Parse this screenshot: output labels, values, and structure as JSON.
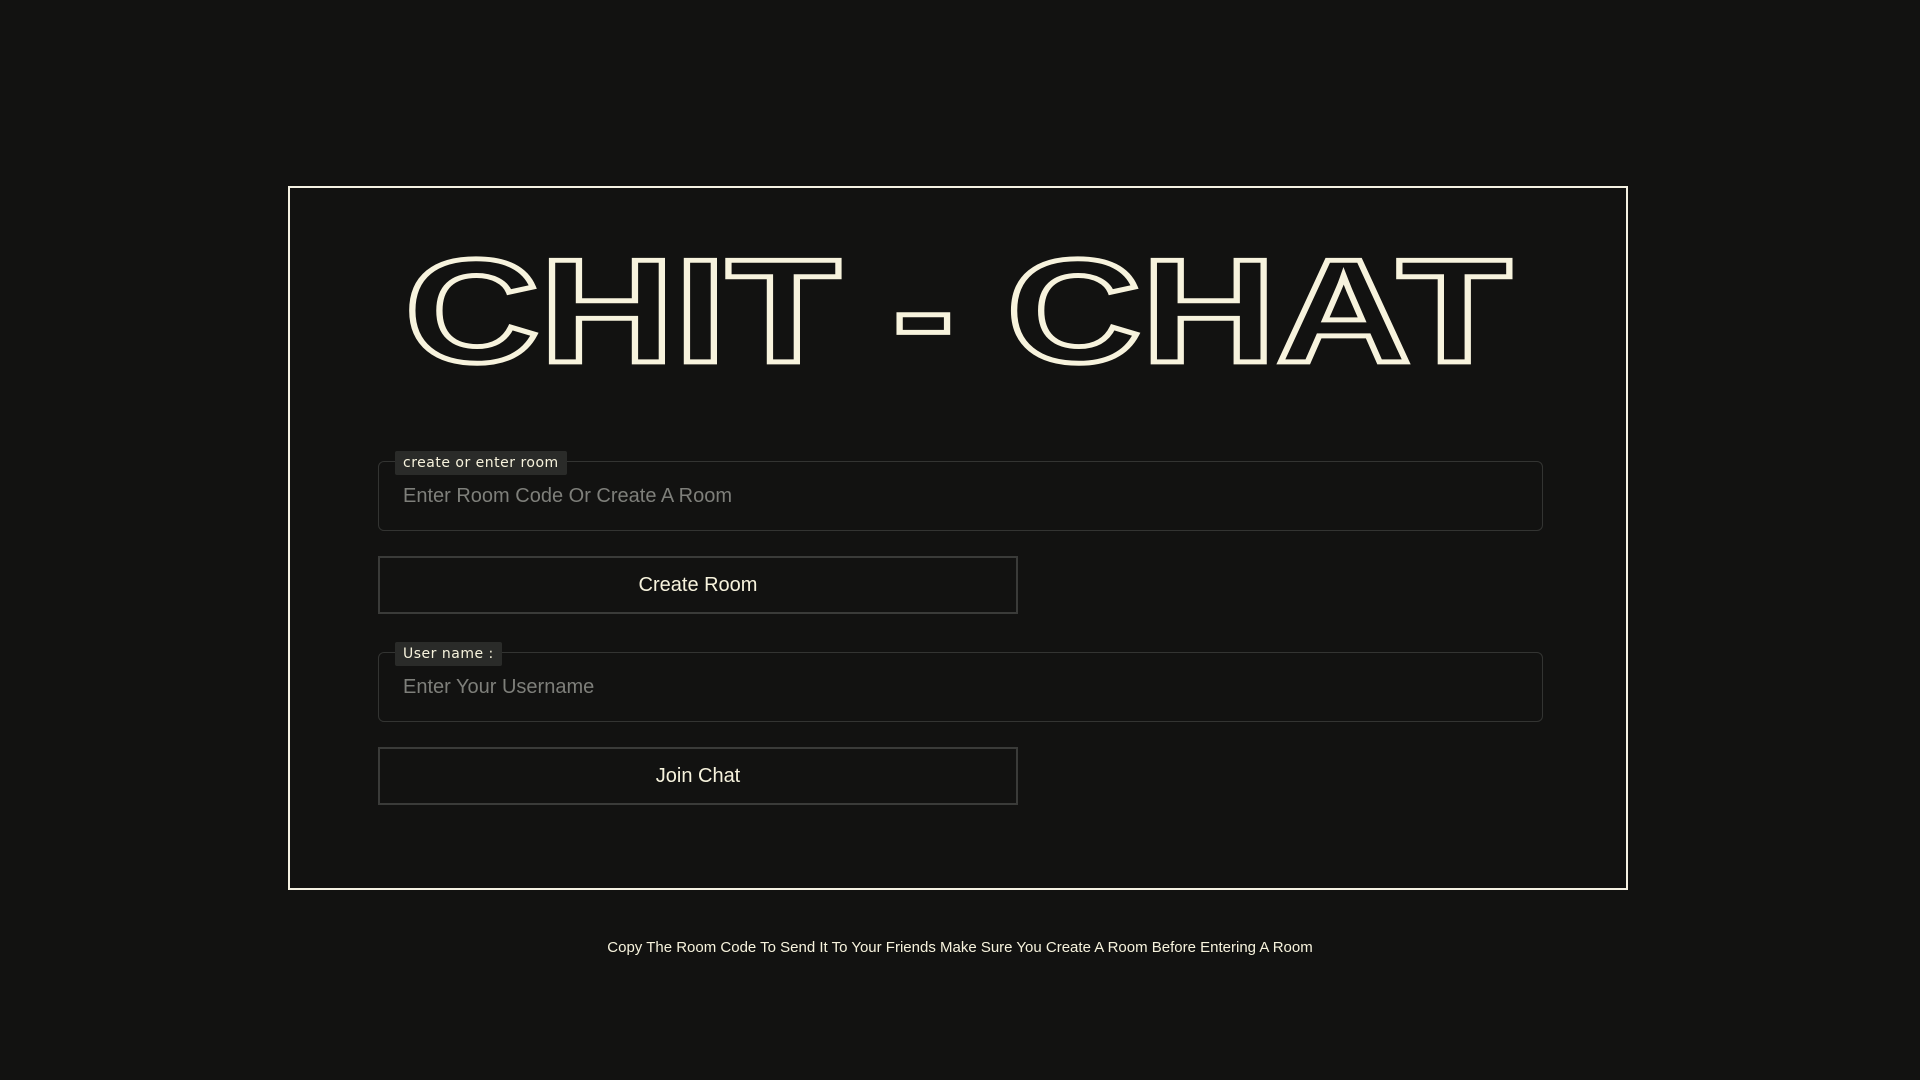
{
  "app": {
    "title": "CHIT - CHAT"
  },
  "room": {
    "label": "create or enter room",
    "placeholder": "Enter Room Code Or Create A Room",
    "value": "",
    "create_button": "Create Room"
  },
  "user": {
    "label": "User name :",
    "placeholder": "Enter Your Username",
    "value": "",
    "join_button": "Join Chat"
  },
  "footer": {
    "note": "Copy The Room Code To Send It To Your Friends Make Sure You Create A Room Before Entering A Room"
  },
  "colors": {
    "background": "#121211",
    "accent": "#f7f3dd",
    "border": "#333432"
  }
}
